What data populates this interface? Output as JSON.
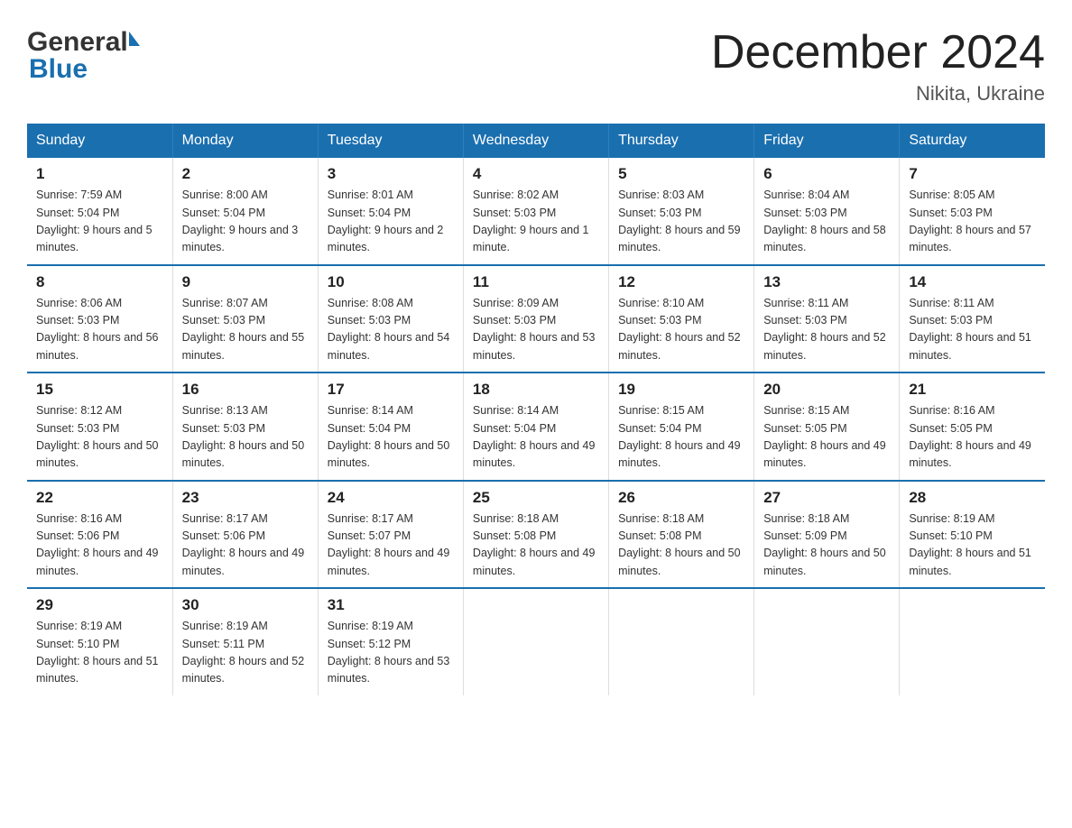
{
  "header": {
    "logo_general": "General",
    "logo_blue": "Blue",
    "month_title": "December 2024",
    "location": "Nikita, Ukraine"
  },
  "weekdays": [
    "Sunday",
    "Monday",
    "Tuesday",
    "Wednesday",
    "Thursday",
    "Friday",
    "Saturday"
  ],
  "weeks": [
    [
      {
        "day": "1",
        "sunrise": "7:59 AM",
        "sunset": "5:04 PM",
        "daylight": "9 hours and 5 minutes."
      },
      {
        "day": "2",
        "sunrise": "8:00 AM",
        "sunset": "5:04 PM",
        "daylight": "9 hours and 3 minutes."
      },
      {
        "day": "3",
        "sunrise": "8:01 AM",
        "sunset": "5:04 PM",
        "daylight": "9 hours and 2 minutes."
      },
      {
        "day": "4",
        "sunrise": "8:02 AM",
        "sunset": "5:03 PM",
        "daylight": "9 hours and 1 minute."
      },
      {
        "day": "5",
        "sunrise": "8:03 AM",
        "sunset": "5:03 PM",
        "daylight": "8 hours and 59 minutes."
      },
      {
        "day": "6",
        "sunrise": "8:04 AM",
        "sunset": "5:03 PM",
        "daylight": "8 hours and 58 minutes."
      },
      {
        "day": "7",
        "sunrise": "8:05 AM",
        "sunset": "5:03 PM",
        "daylight": "8 hours and 57 minutes."
      }
    ],
    [
      {
        "day": "8",
        "sunrise": "8:06 AM",
        "sunset": "5:03 PM",
        "daylight": "8 hours and 56 minutes."
      },
      {
        "day": "9",
        "sunrise": "8:07 AM",
        "sunset": "5:03 PM",
        "daylight": "8 hours and 55 minutes."
      },
      {
        "day": "10",
        "sunrise": "8:08 AM",
        "sunset": "5:03 PM",
        "daylight": "8 hours and 54 minutes."
      },
      {
        "day": "11",
        "sunrise": "8:09 AM",
        "sunset": "5:03 PM",
        "daylight": "8 hours and 53 minutes."
      },
      {
        "day": "12",
        "sunrise": "8:10 AM",
        "sunset": "5:03 PM",
        "daylight": "8 hours and 52 minutes."
      },
      {
        "day": "13",
        "sunrise": "8:11 AM",
        "sunset": "5:03 PM",
        "daylight": "8 hours and 52 minutes."
      },
      {
        "day": "14",
        "sunrise": "8:11 AM",
        "sunset": "5:03 PM",
        "daylight": "8 hours and 51 minutes."
      }
    ],
    [
      {
        "day": "15",
        "sunrise": "8:12 AM",
        "sunset": "5:03 PM",
        "daylight": "8 hours and 50 minutes."
      },
      {
        "day": "16",
        "sunrise": "8:13 AM",
        "sunset": "5:03 PM",
        "daylight": "8 hours and 50 minutes."
      },
      {
        "day": "17",
        "sunrise": "8:14 AM",
        "sunset": "5:04 PM",
        "daylight": "8 hours and 50 minutes."
      },
      {
        "day": "18",
        "sunrise": "8:14 AM",
        "sunset": "5:04 PM",
        "daylight": "8 hours and 49 minutes."
      },
      {
        "day": "19",
        "sunrise": "8:15 AM",
        "sunset": "5:04 PM",
        "daylight": "8 hours and 49 minutes."
      },
      {
        "day": "20",
        "sunrise": "8:15 AM",
        "sunset": "5:05 PM",
        "daylight": "8 hours and 49 minutes."
      },
      {
        "day": "21",
        "sunrise": "8:16 AM",
        "sunset": "5:05 PM",
        "daylight": "8 hours and 49 minutes."
      }
    ],
    [
      {
        "day": "22",
        "sunrise": "8:16 AM",
        "sunset": "5:06 PM",
        "daylight": "8 hours and 49 minutes."
      },
      {
        "day": "23",
        "sunrise": "8:17 AM",
        "sunset": "5:06 PM",
        "daylight": "8 hours and 49 minutes."
      },
      {
        "day": "24",
        "sunrise": "8:17 AM",
        "sunset": "5:07 PM",
        "daylight": "8 hours and 49 minutes."
      },
      {
        "day": "25",
        "sunrise": "8:18 AM",
        "sunset": "5:08 PM",
        "daylight": "8 hours and 49 minutes."
      },
      {
        "day": "26",
        "sunrise": "8:18 AM",
        "sunset": "5:08 PM",
        "daylight": "8 hours and 50 minutes."
      },
      {
        "day": "27",
        "sunrise": "8:18 AM",
        "sunset": "5:09 PM",
        "daylight": "8 hours and 50 minutes."
      },
      {
        "day": "28",
        "sunrise": "8:19 AM",
        "sunset": "5:10 PM",
        "daylight": "8 hours and 51 minutes."
      }
    ],
    [
      {
        "day": "29",
        "sunrise": "8:19 AM",
        "sunset": "5:10 PM",
        "daylight": "8 hours and 51 minutes."
      },
      {
        "day": "30",
        "sunrise": "8:19 AM",
        "sunset": "5:11 PM",
        "daylight": "8 hours and 52 minutes."
      },
      {
        "day": "31",
        "sunrise": "8:19 AM",
        "sunset": "5:12 PM",
        "daylight": "8 hours and 53 minutes."
      },
      null,
      null,
      null,
      null
    ]
  ],
  "labels": {
    "sunrise": "Sunrise:",
    "sunset": "Sunset:",
    "daylight": "Daylight:"
  }
}
